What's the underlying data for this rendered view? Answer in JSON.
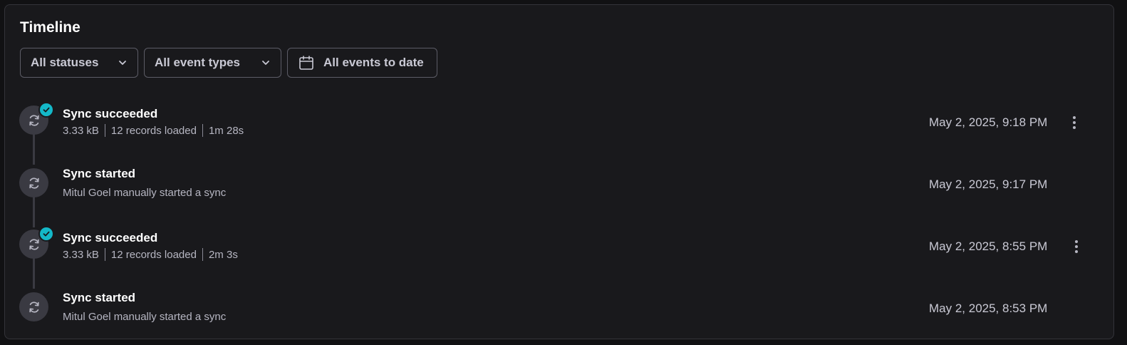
{
  "timeline": {
    "title": "Timeline",
    "filters": {
      "statuses": "All statuses",
      "event_types": "All event types",
      "date_range": "All events to date"
    },
    "events": [
      {
        "title": "Sync succeeded",
        "size": "3.33 kB",
        "records": "12 records loaded",
        "duration": "1m 28s",
        "date": "May 2, 2025, 9:18 PM",
        "status": "success",
        "icon": "sync-icon"
      },
      {
        "title": "Sync started",
        "description": "Mitul Goel manually started a sync",
        "date": "May 2, 2025, 9:17 PM",
        "icon": "sync-icon"
      },
      {
        "title": "Sync succeeded",
        "size": "3.33 kB",
        "records": "12 records loaded",
        "duration": "2m 3s",
        "date": "May 2, 2025, 8:55 PM",
        "status": "success",
        "icon": "sync-icon"
      },
      {
        "title": "Sync started",
        "description": "Mitul Goel manually started a sync",
        "date": "May 2, 2025, 8:53 PM",
        "icon": "sync-icon"
      }
    ],
    "colors": {
      "background": "#19191c",
      "success_badge": "#14b8c8",
      "node": "#3a3a42",
      "text_primary": "#ffffff",
      "text_secondary": "#b6b6c2"
    }
  }
}
